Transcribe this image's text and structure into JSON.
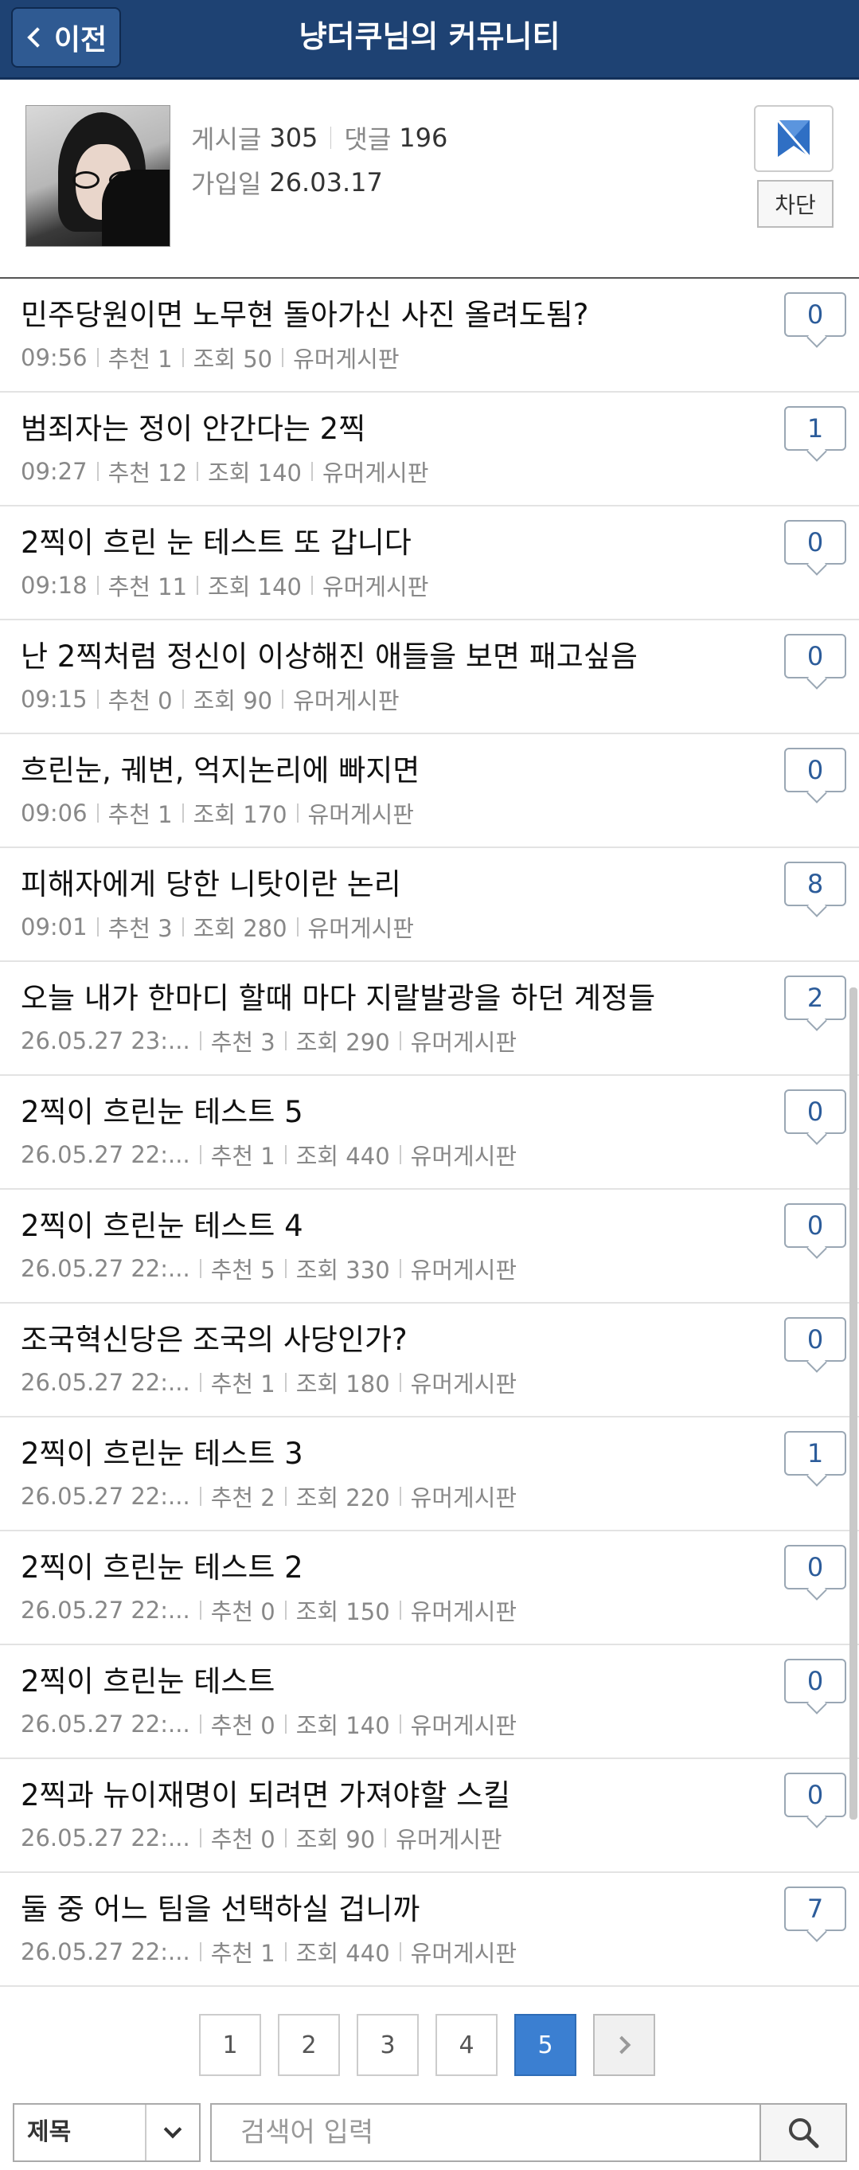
{
  "header": {
    "back_label": "이전",
    "title": "냥더쿠님의 커뮤니티"
  },
  "profile": {
    "posts_label": "게시글",
    "posts_count": "305",
    "comments_label": "댓글",
    "comments_count": "196",
    "joined_label": "가입일",
    "joined_date": "26.03.17",
    "block_label": "차단",
    "badge_icon": "shield-badge-icon"
  },
  "posts": [
    {
      "title": "민주당원이면 노무현 돌아가신 사진 올려도됨?",
      "time": "09:56",
      "rec": "추천 1",
      "views": "조회 50",
      "board": "유머게시판",
      "comments": "0"
    },
    {
      "title": "범죄자는 정이 안간다는 2찍",
      "time": "09:27",
      "rec": "추천 12",
      "views": "조회 140",
      "board": "유머게시판",
      "comments": "1"
    },
    {
      "title": "2찍이 흐린 눈 테스트 또 갑니다",
      "time": "09:18",
      "rec": "추천 11",
      "views": "조회 140",
      "board": "유머게시판",
      "comments": "0"
    },
    {
      "title": "난 2찍처럼 정신이 이상해진 애들을 보면 패고싶음",
      "time": "09:15",
      "rec": "추천 0",
      "views": "조회 90",
      "board": "유머게시판",
      "comments": "0"
    },
    {
      "title": "흐린눈, 궤변, 억지논리에 빠지면",
      "time": "09:06",
      "rec": "추천 1",
      "views": "조회 170",
      "board": "유머게시판",
      "comments": "0"
    },
    {
      "title": "피해자에게 당한 니탓이란 논리",
      "time": "09:01",
      "rec": "추천 3",
      "views": "조회 280",
      "board": "유머게시판",
      "comments": "8"
    },
    {
      "title": "오늘 내가 한마디 할때 마다 지랄발광을 하던 계정들",
      "time": "26.05.27  23:...",
      "rec": "추천 3",
      "views": "조회 290",
      "board": "유머게시판",
      "comments": "2"
    },
    {
      "title": "2찍이 흐린눈 테스트 5",
      "time": "26.05.27  22:...",
      "rec": "추천 1",
      "views": "조회 440",
      "board": "유머게시판",
      "comments": "0"
    },
    {
      "title": "2찍이 흐린눈 테스트 4",
      "time": "26.05.27  22:...",
      "rec": "추천 5",
      "views": "조회 330",
      "board": "유머게시판",
      "comments": "0"
    },
    {
      "title": "조국혁신당은 조국의 사당인가?",
      "time": "26.05.27  22:...",
      "rec": "추천 1",
      "views": "조회 180",
      "board": "유머게시판",
      "comments": "0"
    },
    {
      "title": "2찍이 흐린눈 테스트 3",
      "time": "26.05.27  22:...",
      "rec": "추천 2",
      "views": "조회 220",
      "board": "유머게시판",
      "comments": "1"
    },
    {
      "title": "2찍이 흐린눈 테스트 2",
      "time": "26.05.27  22:...",
      "rec": "추천 0",
      "views": "조회 150",
      "board": "유머게시판",
      "comments": "0"
    },
    {
      "title": "2찍이 흐린눈 테스트",
      "time": "26.05.27  22:...",
      "rec": "추천 0",
      "views": "조회 140",
      "board": "유머게시판",
      "comments": "0"
    },
    {
      "title": "2찍과 뉴이재명이 되려면 가져야할 스킬",
      "time": "26.05.27  22:...",
      "rec": "추천 0",
      "views": "조회 90",
      "board": "유머게시판",
      "comments": "0"
    },
    {
      "title": "둘 중 어느 팀을 선택하실 겁니까",
      "time": "26.05.27  22:...",
      "rec": "추천 1",
      "views": "조회 440",
      "board": "유머게시판",
      "comments": "7"
    }
  ],
  "pagination": {
    "pages": [
      "1",
      "2",
      "3",
      "4",
      "5"
    ],
    "current": "5",
    "next_icon": "chevron-right-icon"
  },
  "search": {
    "select_value": "제목",
    "placeholder": "검색어 입력",
    "button_icon": "search-icon"
  },
  "colors": {
    "header_bg": "#1e4273",
    "accent": "#3b7fd1",
    "comment_count": "#2c5c9a"
  }
}
